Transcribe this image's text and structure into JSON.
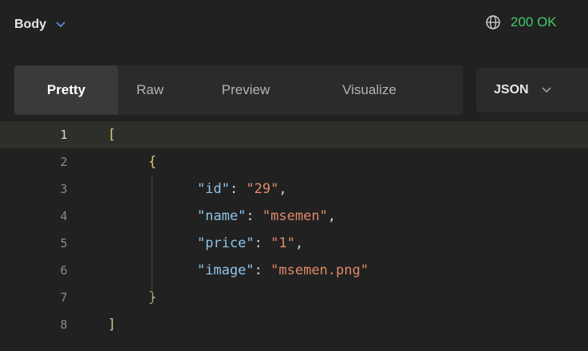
{
  "header": {
    "body_label": "Body",
    "status_text": "200 OK",
    "status_color": "#3fcd6a",
    "icons": {
      "body_dropdown": "chevron-down-icon",
      "network": "globe-icon"
    }
  },
  "toolbar": {
    "tabs": [
      {
        "label": "Pretty",
        "active": true
      },
      {
        "label": "Raw",
        "active": false
      },
      {
        "label": "Preview",
        "active": false
      },
      {
        "label": "Visualize",
        "active": false
      }
    ],
    "format_selected": "JSON"
  },
  "editor": {
    "lines": [
      {
        "number": "1",
        "open_bracket": "["
      },
      {
        "number": "2",
        "open_brace": "{"
      },
      {
        "number": "3",
        "key": "\"id\"",
        "colon": ": ",
        "value": "\"29\"",
        "comma": ","
      },
      {
        "number": "4",
        "key": "\"name\"",
        "colon": ": ",
        "value": "\"msemen\"",
        "comma": ","
      },
      {
        "number": "5",
        "key": "\"price\"",
        "colon": ": ",
        "value": "\"1\"",
        "comma": ","
      },
      {
        "number": "6",
        "key": "\"image\"",
        "colon": ": ",
        "value": "\"msemen.png\""
      },
      {
        "number": "7",
        "close_brace": "}"
      },
      {
        "number": "8",
        "close_bracket": "]"
      }
    ]
  }
}
